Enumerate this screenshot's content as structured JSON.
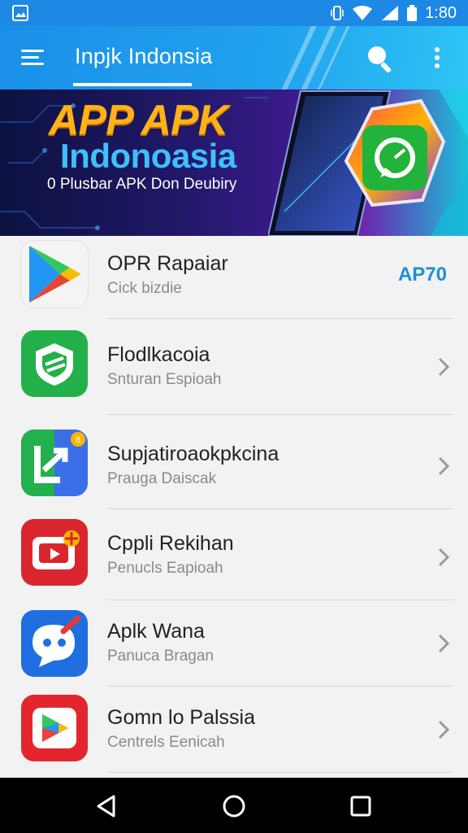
{
  "status_bar": {
    "time": "1:80",
    "icons": [
      "gallery-icon",
      "vibrate-icon",
      "wifi-icon",
      "signal-icon",
      "battery-icon"
    ]
  },
  "app_bar": {
    "title": "Inpjk Indonsia",
    "icons": [
      "menu-icon",
      "search-icon",
      "more-vert-icon"
    ]
  },
  "banner": {
    "headline": "APP APK",
    "subtitle": "Indonoasia",
    "tagline": "0 Plusbar APK Don Deubiry"
  },
  "apps": [
    {
      "name": "OPR Rapaiar",
      "subtitle": "Cick bizdie",
      "badge": "AP70",
      "icon": "play-store-icon"
    },
    {
      "name": "Flodlkacoia",
      "subtitle": "Snturan Espioah",
      "icon": "green-shield-icon"
    },
    {
      "name": "Supjatiroaokpkcina",
      "subtitle": "Prauga Daiscak",
      "icon": "arrow-box-icon"
    },
    {
      "name": "Cppli Rekihan",
      "subtitle": "Penucls Eapioah",
      "icon": "red-video-icon"
    },
    {
      "name": "Aplk Wana",
      "subtitle": "Panuca Bragan",
      "icon": "chat-bubble-icon"
    },
    {
      "name": "Gomn lo Palssia",
      "subtitle": "Centrels Eenicah",
      "icon": "red-play-icon"
    }
  ],
  "colors": {
    "app_bar": "#1e88e5",
    "accent": "#1e8fd8",
    "banner_headline": "#ffb316",
    "banner_subtitle": "#3ec0ff"
  },
  "nav_bar": {
    "buttons": [
      "back-icon",
      "home-icon",
      "recents-icon"
    ]
  }
}
